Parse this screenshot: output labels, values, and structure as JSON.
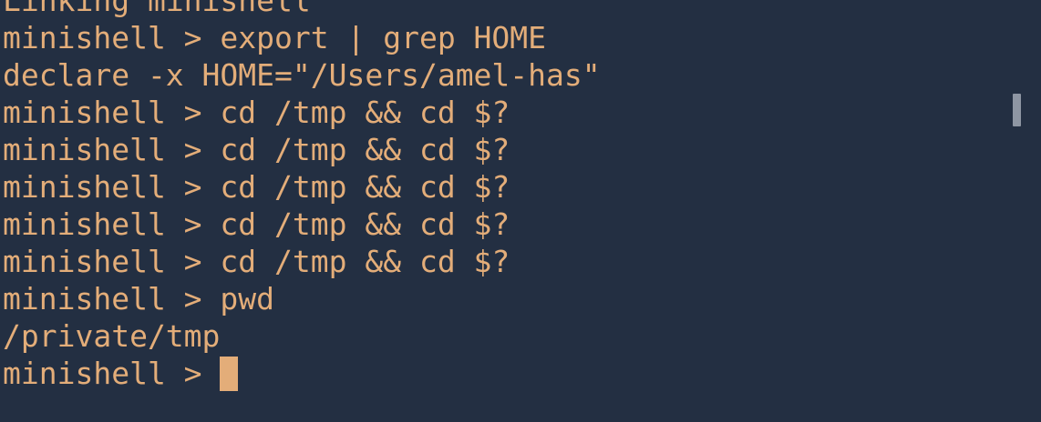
{
  "terminal": {
    "lines": [
      "Linking minishell",
      "minishell > export | grep HOME",
      "declare -x HOME=\"/Users/amel-has\"",
      "minishell > cd /tmp && cd $?",
      "minishell > cd /tmp && cd $?",
      "minishell > cd /tmp && cd $?",
      "minishell > cd /tmp && cd $?",
      "minishell > cd /tmp && cd $?",
      "minishell > pwd",
      "/private/tmp"
    ],
    "prompt": "minishell > ",
    "colors": {
      "background": "#232f42",
      "text": "#e3ad79",
      "cursor": "#e3ad79",
      "scrollbar": "#8e96a3"
    }
  }
}
